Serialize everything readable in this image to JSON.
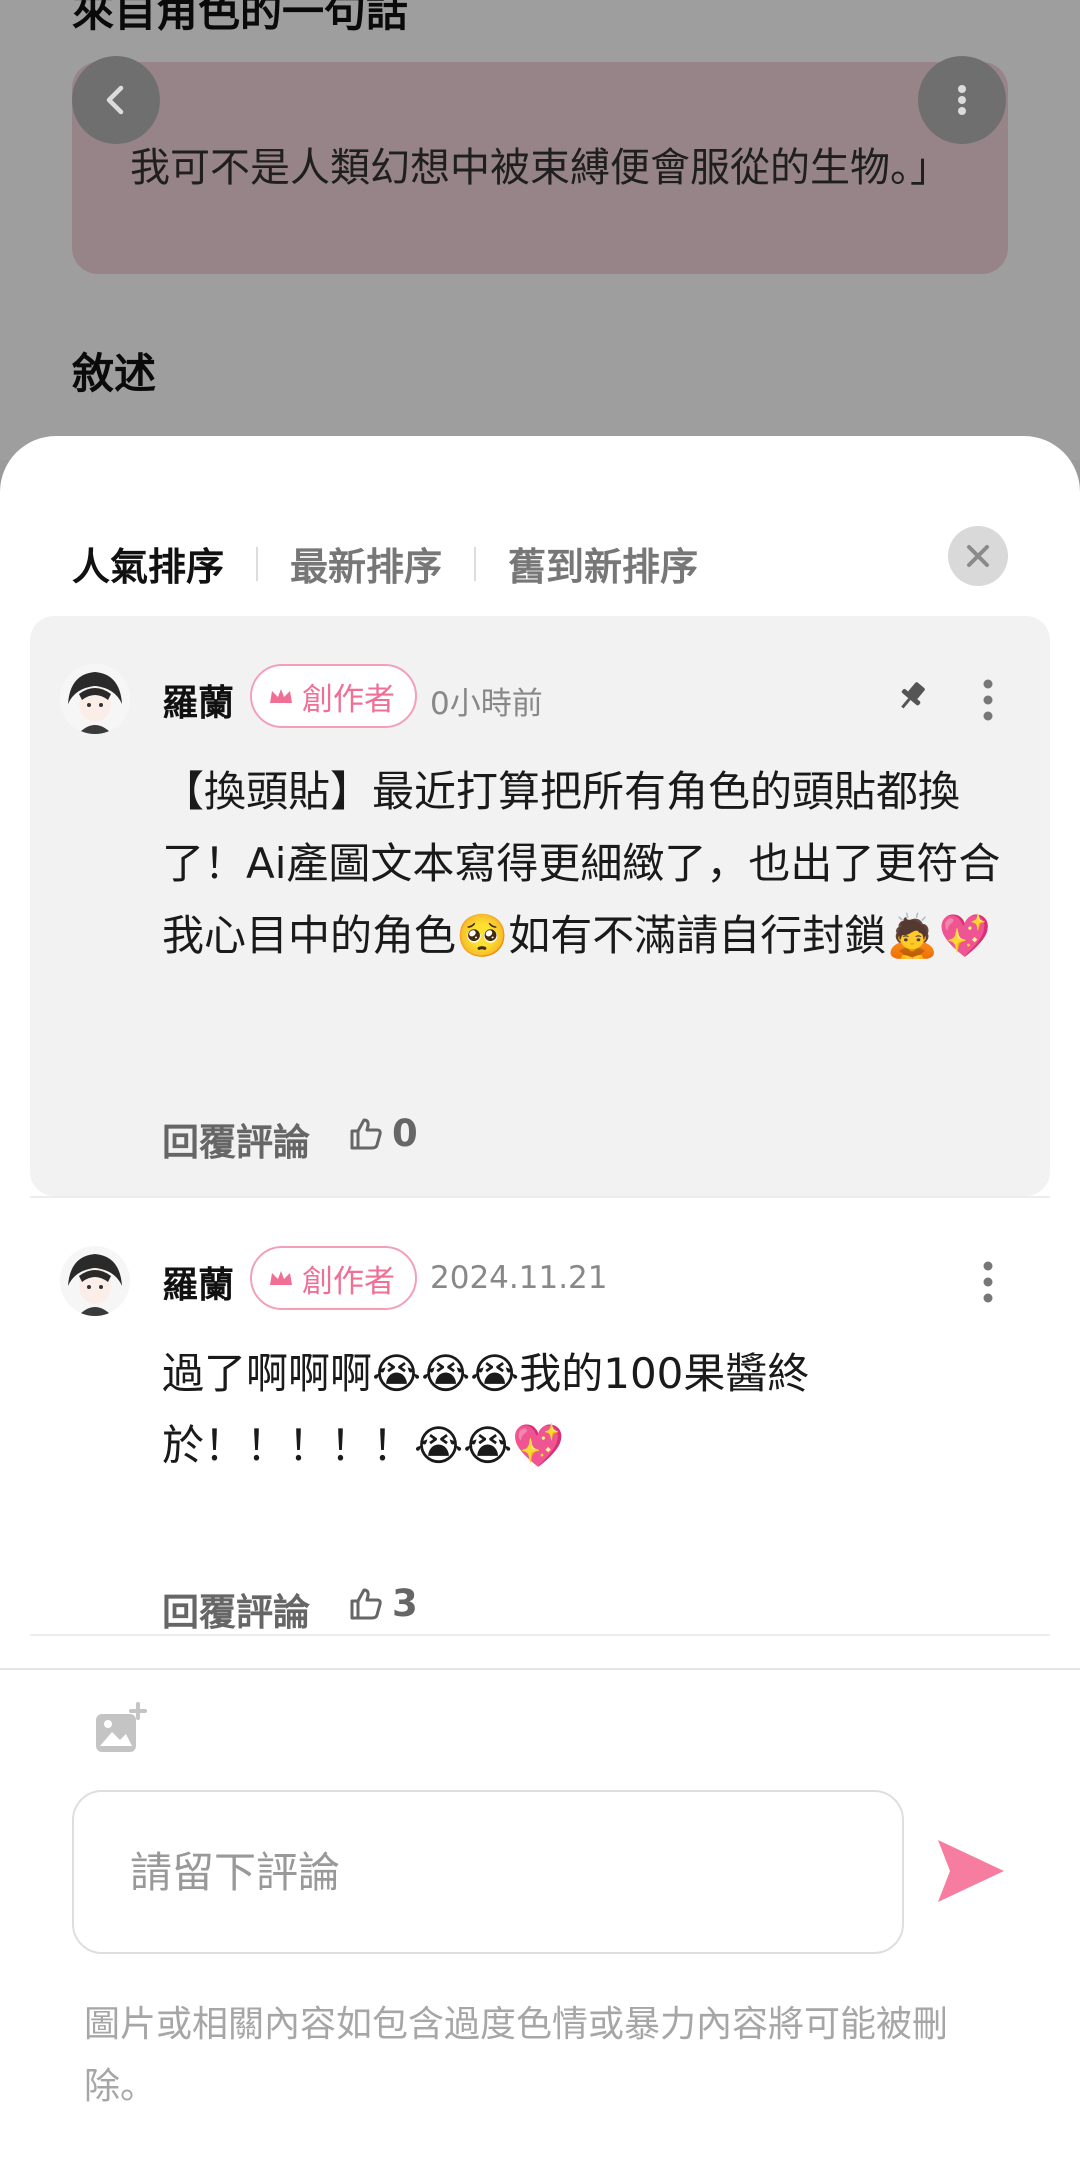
{
  "background": {
    "heading_top": "來自角色的一句話",
    "quote": "我可不是人類幻想中被束縛便會服從的生物。」",
    "heading_narration": "敘述"
  },
  "sheet": {
    "tabs": [
      "人氣排序",
      "最新排序",
      "舊到新排序"
    ],
    "active_tab_index": 0
  },
  "comments": [
    {
      "author": "羅蘭",
      "badge": "創作者",
      "time": "0小時前",
      "pinned": true,
      "body": "【換頭貼】最近打算把所有角色的頭貼都換了！Ai產圖文本寫得更細緻了，也出了更符合我心目中的角色🥺如有不滿請自行封鎖🙇💖",
      "reply_label": "回覆評論",
      "likes": "0"
    },
    {
      "author": "羅蘭",
      "badge": "創作者",
      "time": "2024.11.21",
      "pinned": false,
      "body": "過了啊啊啊😭😭😭我的100果醬終\n於！！！！！😭😭💖",
      "reply_label": "回覆評論",
      "likes": "3"
    }
  ],
  "composer": {
    "placeholder": "請留下評論",
    "notice": "圖片或相關內容如包含過度色情或暴力內容將可能被刪除。"
  },
  "colors": {
    "accent_pink": "#f06f95",
    "badge_border": "#f3a0b7",
    "quote_bg": "#f4d6de",
    "send_pink": "#f77da0"
  },
  "icons": [
    "chevron-left-icon",
    "more-vertical-icon",
    "close-icon",
    "pin-icon",
    "crown-icon",
    "thumbs-up-icon",
    "image-add-icon",
    "send-icon"
  ]
}
